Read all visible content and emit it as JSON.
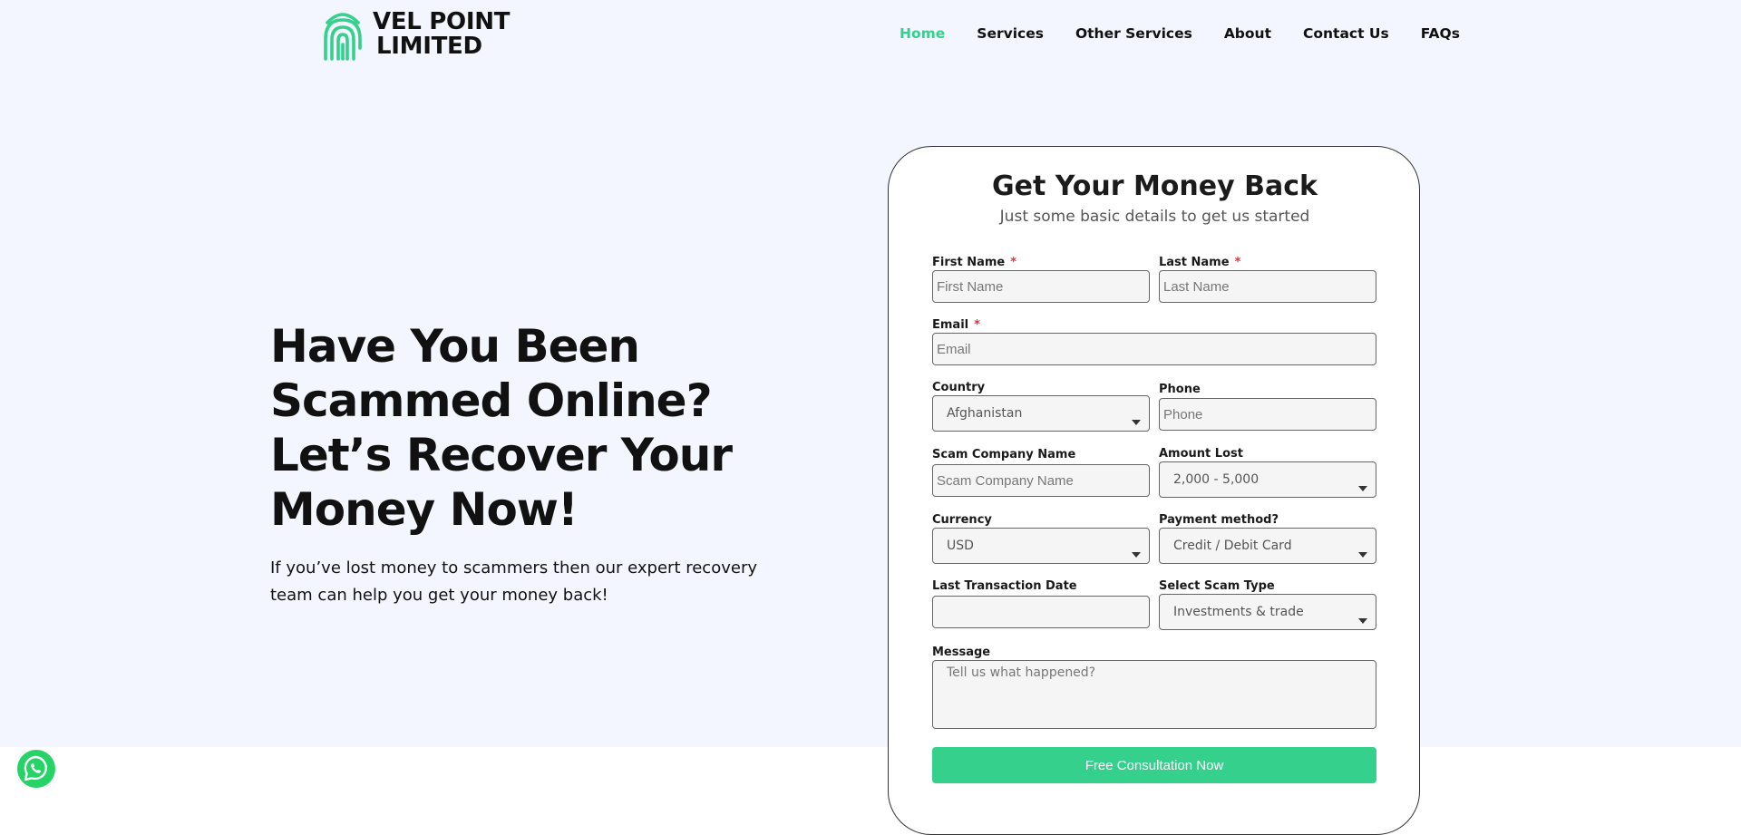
{
  "header": {
    "logo_line1": "VEL POINT",
    "logo_line2": "LIMITED",
    "nav": [
      "Home",
      "Services",
      "Other Services",
      "About",
      "Contact Us",
      "FAQs"
    ],
    "active_nav": "Home"
  },
  "hero": {
    "title": "Have You Been Scammed Online? Let’s Recover Your Money Now!",
    "subtitle": "If you’ve lost money to scammers then our expert recovery team can help you get your money back!"
  },
  "form": {
    "title": "Get Your Money Back",
    "subtitle": "Just some basic details to get us started",
    "first_name": {
      "label": "First Name",
      "placeholder": "First Name",
      "required_mark": "*"
    },
    "last_name": {
      "label": "Last Name",
      "placeholder": "Last Name",
      "required_mark": "*"
    },
    "email": {
      "label": "Email",
      "placeholder": "Email",
      "required_mark": "*"
    },
    "country": {
      "label": "Country",
      "value": "Afghanistan"
    },
    "phone": {
      "label": "Phone",
      "placeholder": "Phone"
    },
    "scam_company": {
      "label": "Scam Company Name",
      "placeholder": "Scam Company Name"
    },
    "amount_lost": {
      "label": "Amount Lost",
      "value": "2,000 - 5,000"
    },
    "currency": {
      "label": "Currency",
      "value": "USD"
    },
    "payment_method": {
      "label": "Payment method?",
      "value": "Credit / Debit Card"
    },
    "last_transaction_date": {
      "label": "Last Transaction Date",
      "value": ""
    },
    "scam_type": {
      "label": "Select Scam Type",
      "value": "Investments & trade"
    },
    "message": {
      "label": "Message",
      "placeholder": "Tell us what happened?"
    },
    "submit_label": "Free Consultation Now"
  },
  "colors": {
    "accent": "#34d08c",
    "hero_background": "#f3f6ff",
    "required": "#e0303c",
    "whatsapp": "#25d366"
  },
  "icons": {
    "logo": "fingerprint-icon",
    "chat": "whatsapp-icon"
  }
}
